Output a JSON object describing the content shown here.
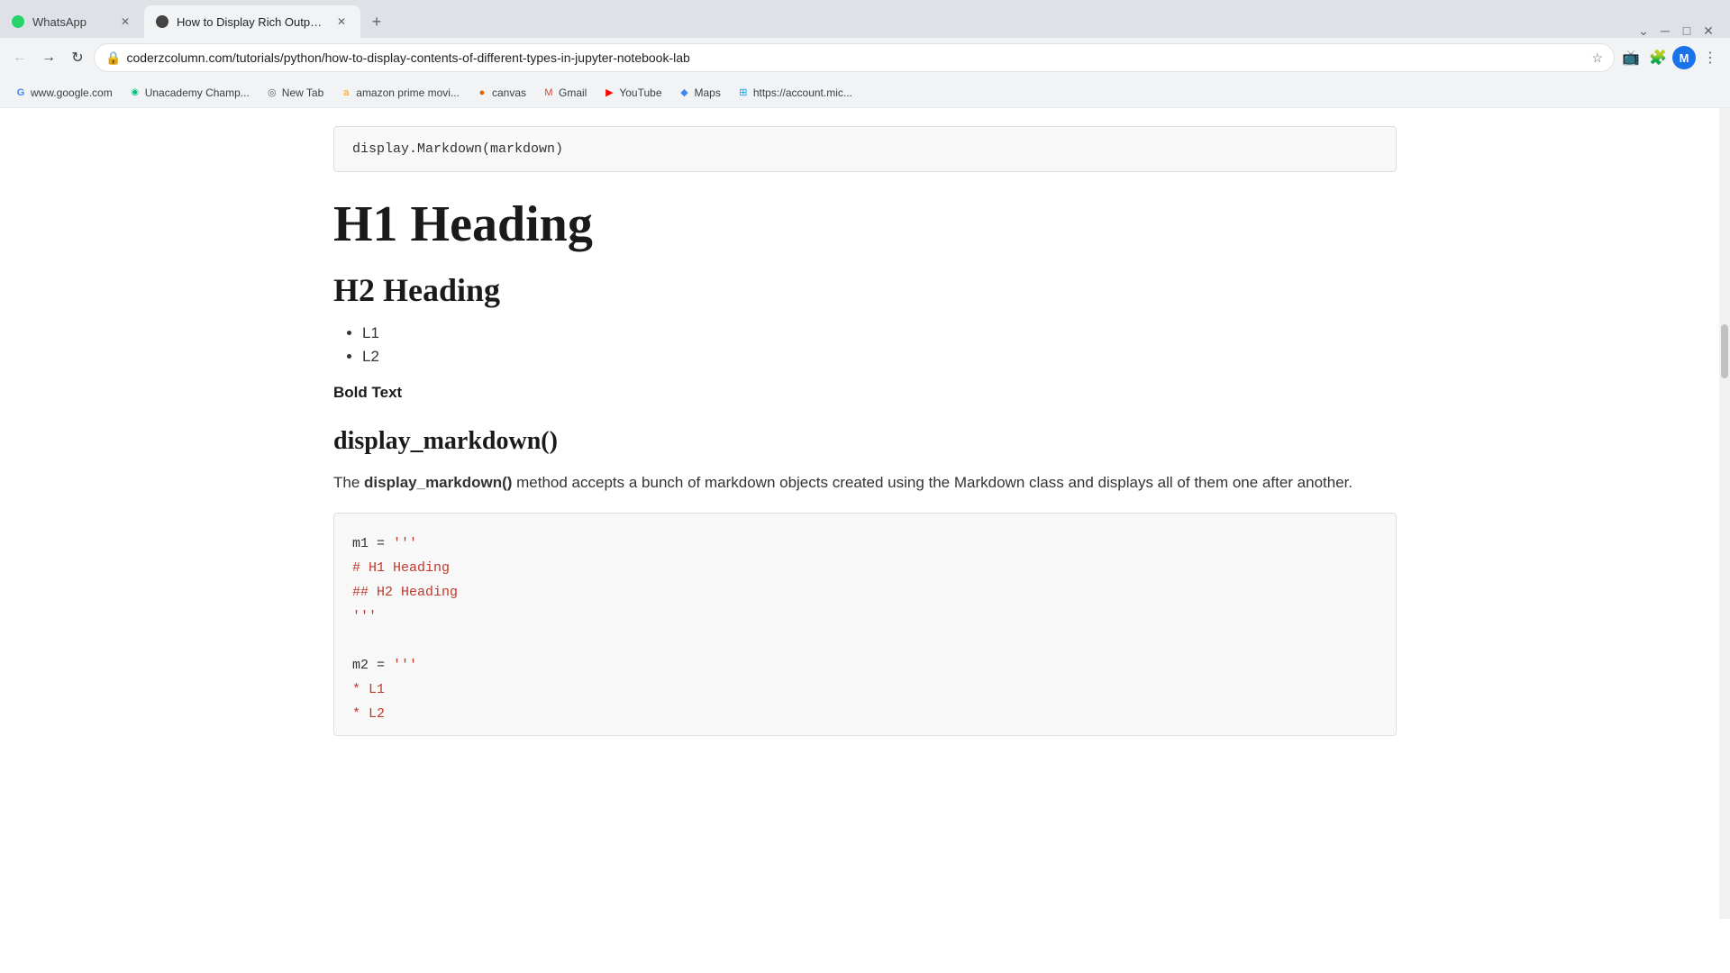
{
  "browser": {
    "tabs": [
      {
        "id": "whatsapp",
        "title": "WhatsApp",
        "active": false,
        "favicon_type": "whatsapp"
      },
      {
        "id": "coderzcolumn",
        "title": "How to Display Rich Outputs (in...",
        "active": true,
        "favicon_type": "circle-dark"
      }
    ],
    "address": "coderzcolumn.com/tutorials/python/how-to-display-contents-of-different-types-in-jupyter-notebook-lab",
    "bookmarks": [
      {
        "id": "google",
        "label": "www.google.com",
        "favicon": "G"
      },
      {
        "id": "unacademy",
        "label": "Unacademy Champ...",
        "favicon": "U"
      },
      {
        "id": "new-tab",
        "label": "New Tab",
        "favicon": "★"
      },
      {
        "id": "amazon",
        "label": "amazon prime movi...",
        "favicon": "a"
      },
      {
        "id": "canvas",
        "label": "canvas",
        "favicon": "c"
      },
      {
        "id": "gmail",
        "label": "Gmail",
        "favicon": "M"
      },
      {
        "id": "youtube",
        "label": "YouTube",
        "favicon": "▶"
      },
      {
        "id": "maps",
        "label": "Maps",
        "favicon": "◆"
      },
      {
        "id": "microsoft",
        "label": "https://account.mic...",
        "favicon": "⊞"
      }
    ]
  },
  "page": {
    "code_top": "display.Markdown(markdown)",
    "h1": "H1 Heading",
    "h2": "H2 Heading",
    "list_items": [
      "L1",
      "L2"
    ],
    "bold_text": "Bold Text",
    "func_name": "display_markdown()",
    "description_prefix": "The ",
    "description_bold": "display_markdown()",
    "description_suffix": " method accepts a bunch of markdown objects created using the Markdown class and displays all of them one after another.",
    "code_block": {
      "line1_normal": "m1 = ",
      "line1_string": "'''",
      "line2_string": "# H1 Heading",
      "line3_string": "## H2 Heading",
      "line4_string": "'''",
      "line5_empty": "",
      "line6_normal": "m2 = ",
      "line6_string": "'''",
      "line7_string": "* L1",
      "line8_string": "* L2"
    }
  }
}
